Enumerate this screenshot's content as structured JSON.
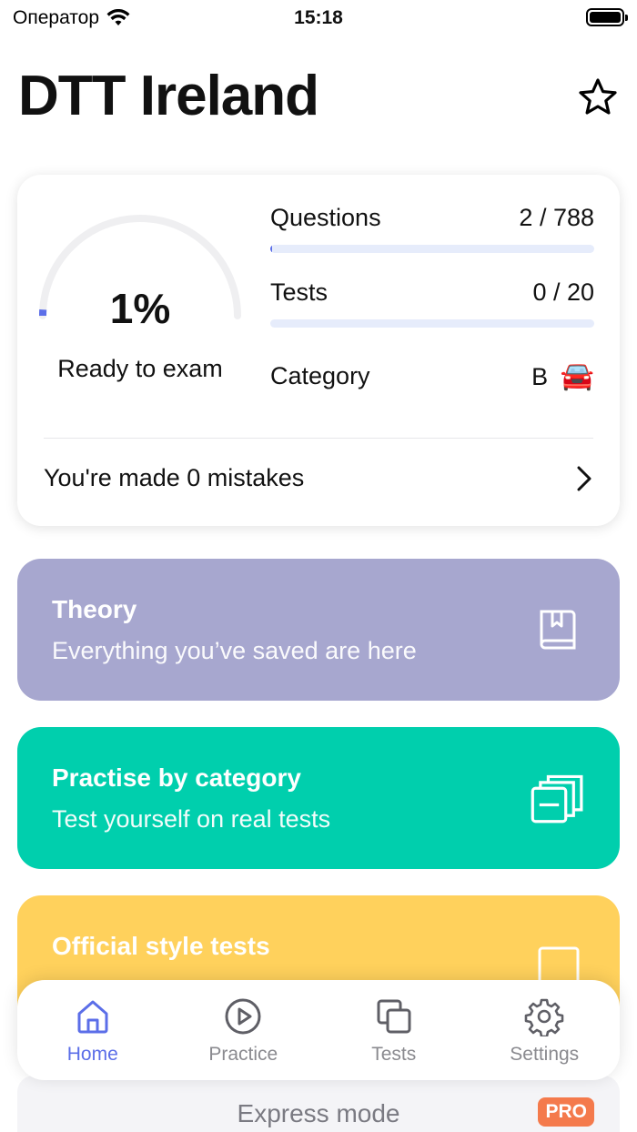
{
  "status_bar": {
    "carrier": "Оператор",
    "time": "15:18"
  },
  "header": {
    "title": "DTT Ireland"
  },
  "stats": {
    "readiness_percent": "1%",
    "readiness_value": 1,
    "readiness_label": "Ready to exam",
    "questions_label": "Questions",
    "questions_value": "2 / 788",
    "questions_progress": 0.0025,
    "tests_label": "Tests",
    "tests_value": "0 / 20",
    "tests_progress": 0,
    "category_label": "Category",
    "category_value": "B",
    "category_emoji": "🚘",
    "mistakes_text": "You're made 0 mistakes"
  },
  "features": {
    "theory": {
      "title": "Theory",
      "subtitle": "Everything you’ve saved are here"
    },
    "practise": {
      "title": "Practise by category",
      "subtitle": "Test yourself on real tests"
    },
    "official": {
      "title": "Official style tests"
    }
  },
  "express": {
    "label": "Express mode",
    "badge": "PRO"
  },
  "tabs": [
    {
      "label": "Home",
      "icon": "home-icon",
      "active": true
    },
    {
      "label": "Practice",
      "icon": "play-icon",
      "active": false
    },
    {
      "label": "Tests",
      "icon": "copy-icon",
      "active": false
    },
    {
      "label": "Settings",
      "icon": "gear-icon",
      "active": false
    }
  ],
  "colors": {
    "accent": "#5b6ee8",
    "theory": "#a7a7cf",
    "practise": "#00cfad",
    "official": "#ffd15c",
    "pro": "#f47a4c"
  }
}
